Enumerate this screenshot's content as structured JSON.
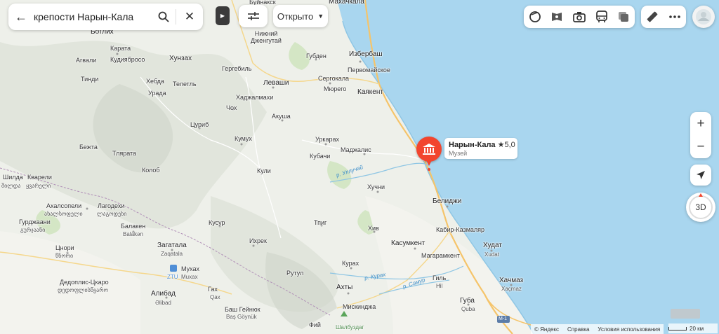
{
  "search": {
    "query": "крепости Нарын-Кала"
  },
  "filters": {
    "open_label": "Открыто"
  },
  "poi": {
    "name": "Нарын-Кала",
    "rating": "5,0",
    "category": "Музей"
  },
  "controls": {
    "zoom_in": "+",
    "zoom_out": "−",
    "btn_3d": "3D"
  },
  "footer": {
    "copyright": "© Яндекс",
    "help": "Справка",
    "terms": "Условия использования",
    "scale": "20 км"
  },
  "colors": {
    "sea": "#a9d6ef",
    "poi": "#f2452e",
    "route": "#f5c46a",
    "land": "#eef0ea"
  },
  "places": [
    {
      "text": "Буйнакск"
    },
    {
      "text": "Махачкала"
    },
    {
      "text": "Ботлих"
    },
    {
      "text": "Карата"
    },
    {
      "text": "Кудиябросо"
    },
    {
      "text": "Хунзах"
    },
    {
      "text": "Агвали"
    },
    {
      "text": "Тинди"
    },
    {
      "text": "Хебда"
    },
    {
      "text": "Урада"
    },
    {
      "text": "Телетль"
    },
    {
      "text": "Гергебиль"
    },
    {
      "text": "Нижний Дженгутай"
    },
    {
      "text": "Губден"
    },
    {
      "text": "Избербаш"
    },
    {
      "text": "Первомайское"
    },
    {
      "text": "Сергокала"
    },
    {
      "text": "Мюрего"
    },
    {
      "text": "Леваши"
    },
    {
      "text": "Хаджалмахи"
    },
    {
      "text": "Каякент"
    },
    {
      "text": "Чох"
    },
    {
      "text": "Акуша"
    },
    {
      "text": "Цуриб"
    },
    {
      "text": "Кумух"
    },
    {
      "text": "Уркарах"
    },
    {
      "text": "Маджалис"
    },
    {
      "text": "Кубачи"
    },
    {
      "text": "Бежта"
    },
    {
      "text": "Тлярата"
    },
    {
      "text": "Колоб"
    },
    {
      "text": "Кули"
    },
    {
      "text": "Шилда"
    },
    {
      "text": "Кварели"
    },
    {
      "text": "შილდა"
    },
    {
      "text": "ყვარელი"
    },
    {
      "text": "Хучни"
    },
    {
      "text": "Белиджи"
    },
    {
      "text": "Ахалсопели"
    },
    {
      "text": "Лагодехи"
    },
    {
      "text": "ახალსოფელი"
    },
    {
      "text": "ლაგოდეხი"
    },
    {
      "text": "Гурджаани"
    },
    {
      "text": "გურჯაანი"
    },
    {
      "text": "Балакен"
    },
    {
      "text": "Balakən"
    },
    {
      "text": "Кусур"
    },
    {
      "text": "Тпиг"
    },
    {
      "text": "Хив"
    },
    {
      "text": "Кабир-Казмаляр"
    },
    {
      "text": "Ихрек"
    },
    {
      "text": "Касумкент"
    },
    {
      "text": "Худат"
    },
    {
      "text": "Xudat"
    },
    {
      "text": "Цнори"
    },
    {
      "text": "წნორი"
    },
    {
      "text": "Загатала"
    },
    {
      "text": "Zaqatala"
    },
    {
      "text": "Магарамкент"
    },
    {
      "text": "Курах"
    },
    {
      "text": "Мухах"
    },
    {
      "text": "Muxax"
    },
    {
      "text": "ZTU"
    },
    {
      "text": "Рутул"
    },
    {
      "text": "Дедоплис-Цкаро"
    },
    {
      "text": "დედოფლისწყარო"
    },
    {
      "text": "Хачмаз"
    },
    {
      "text": "Xaçmaz"
    },
    {
      "text": "Гиль"
    },
    {
      "text": "Hil"
    },
    {
      "text": "Гах"
    },
    {
      "text": "Qax"
    },
    {
      "text": "Ахты"
    },
    {
      "text": "Алибад"
    },
    {
      "text": "Əlibad"
    },
    {
      "text": "Баш Гейнюк"
    },
    {
      "text": "Baş Göynük"
    },
    {
      "text": "Мискинджа"
    },
    {
      "text": "Губа"
    },
    {
      "text": "Quba"
    },
    {
      "text": "Фий"
    },
    {
      "text": "Шалбуздаг"
    },
    {
      "text": "М-1"
    }
  ],
  "rivers": [
    {
      "text": "р. Уллучай"
    },
    {
      "text": "р. Курах"
    },
    {
      "text": "р. Самур"
    }
  ]
}
